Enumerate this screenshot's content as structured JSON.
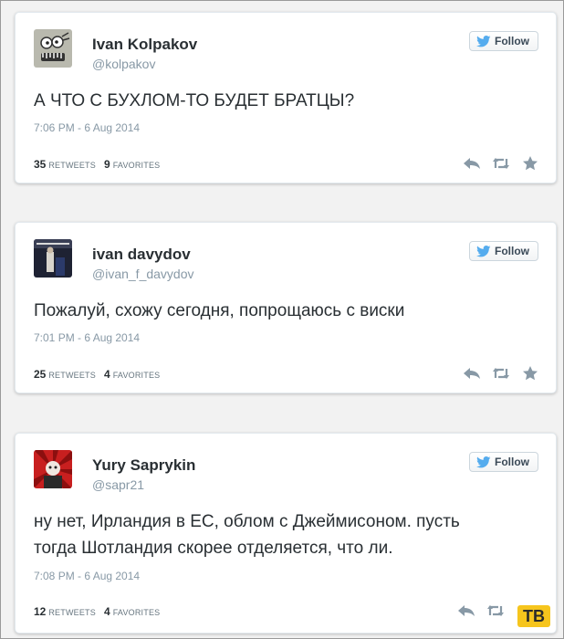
{
  "ui": {
    "follow_label": "Follow",
    "retweets_label": "RETWEETS",
    "favorites_label": "FAVORITES"
  },
  "tweets": [
    {
      "name": "Ivan Kolpakov",
      "handle": "@kolpakov",
      "text": "А ЧТО С БУХЛОМ-ТО БУДЕТ БРАТЦЫ?",
      "time": "7:06 PM - 6 Aug 2014",
      "retweets": "35",
      "favorites": "9"
    },
    {
      "name": "ivan davydov",
      "handle": "@ivan_f_davydov",
      "text": "Пожалуй, схожу сегодня, попрощаюсь с виски",
      "time": "7:01 PM - 6 Aug 2014",
      "retweets": "25",
      "favorites": "4"
    },
    {
      "name": "Yury Saprykin",
      "handle": "@sapr21",
      "text_line1": "ну нет, Ирландия в ЕС,  облом с Джеймисоном. пусть",
      "text_line2": "тогда Шотландия скорее отделяется, что ли.",
      "time": "7:08 PM - 6 Aug 2014",
      "retweets": "12",
      "favorites": "4"
    }
  ],
  "watermark": "ТВ",
  "colors": {
    "twitter_blue": "#55acee",
    "name": "#292f33",
    "muted": "#8899a6",
    "action_icon": "#8899a6",
    "watermark_bg": "#f6c51d"
  }
}
